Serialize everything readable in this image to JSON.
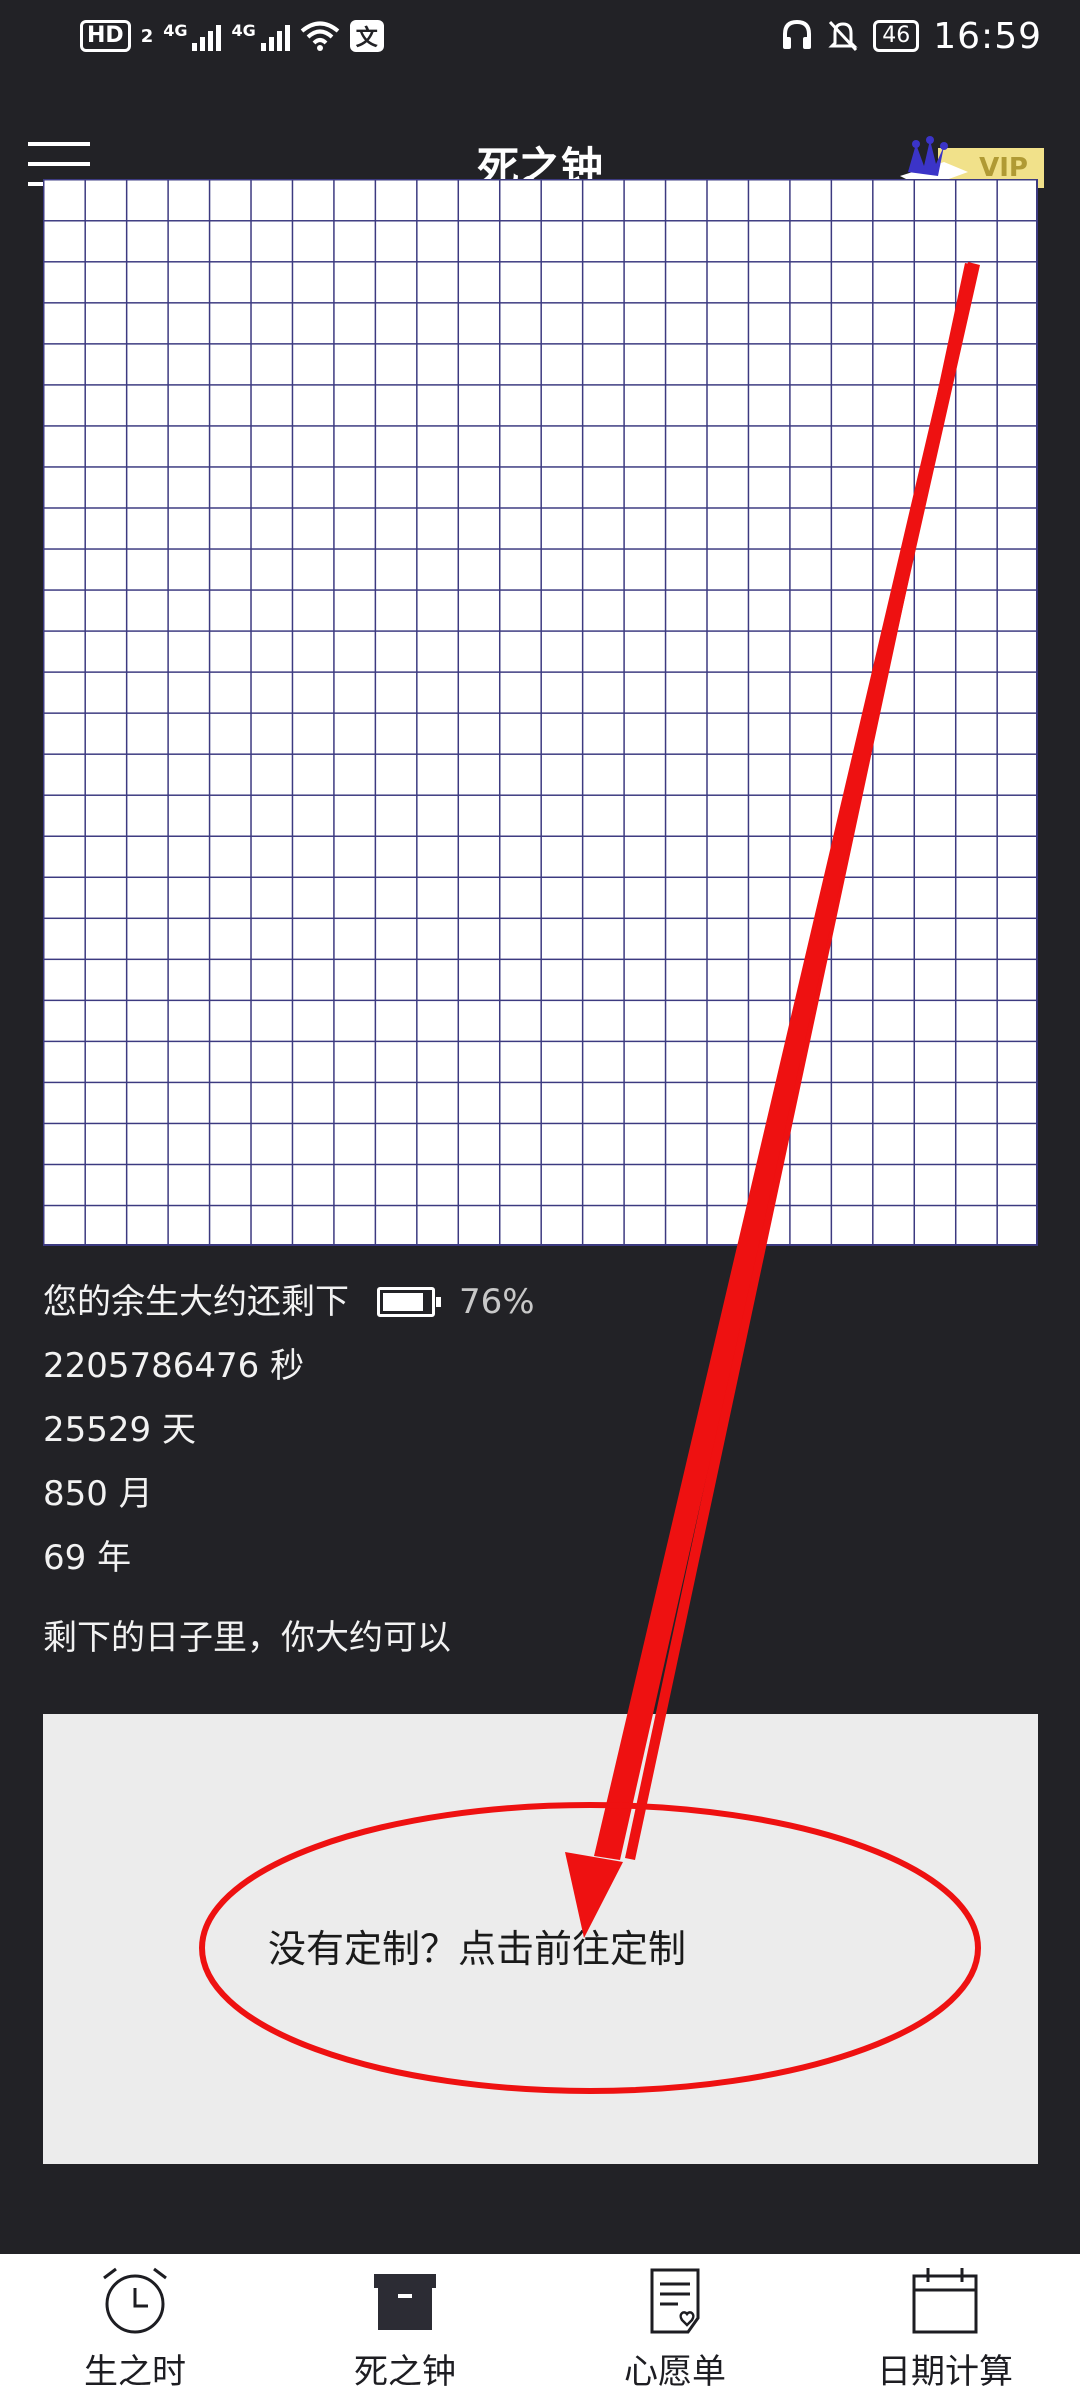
{
  "status_bar": {
    "hd": "HD",
    "hd_sub": "2",
    "net1": "4G",
    "net2": "4G",
    "x_badge": "文",
    "battery": "46",
    "time": "16:59"
  },
  "header": {
    "title": "死之钟",
    "vip_label": "VIP"
  },
  "stats": {
    "remaining_label": "您的余生大约还剩下",
    "remaining_percent": "76%",
    "remaining_fraction": 0.76,
    "seconds": "2205786476 秒",
    "days": "25529 天",
    "months": "850 月",
    "years": "69 年",
    "can_do_label": "剩下的日子里，你大约可以"
  },
  "custom": {
    "link_text": "没有定制？点击前往定制"
  },
  "bottom_nav": [
    {
      "label": "生之时",
      "icon": "alarm-clock-icon"
    },
    {
      "label": "死之钟",
      "icon": "box-icon"
    },
    {
      "label": "心愿单",
      "icon": "wishlist-icon"
    },
    {
      "label": "日期计算",
      "icon": "calendar-icon"
    }
  ],
  "annotation": {
    "color": "#ee1111"
  }
}
